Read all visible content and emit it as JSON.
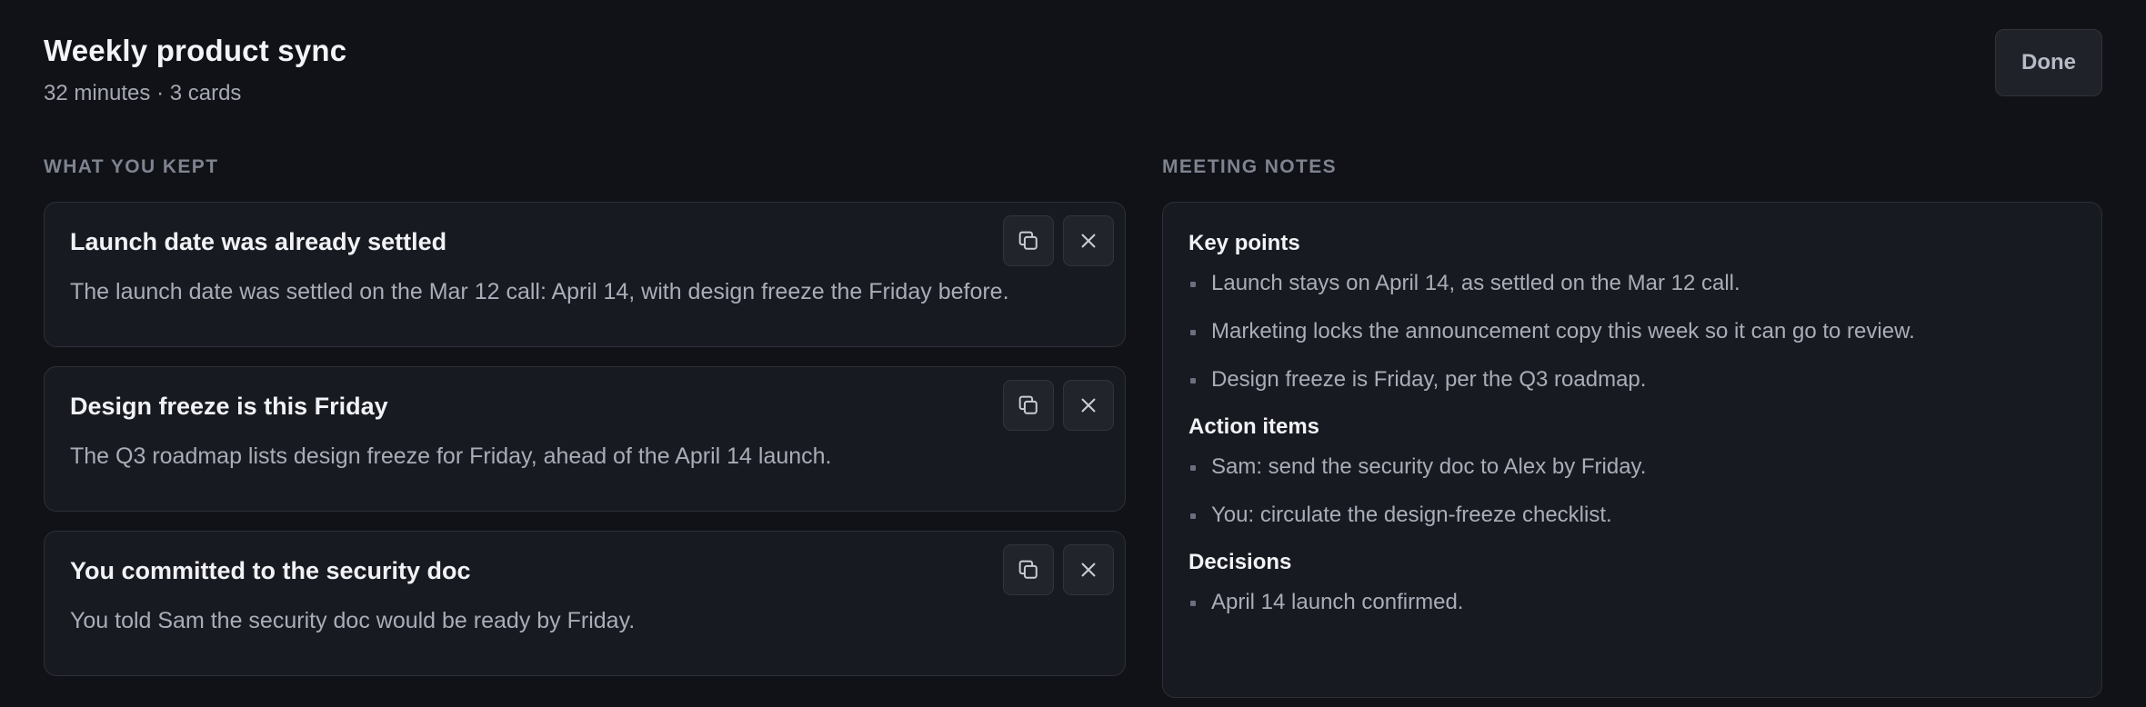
{
  "header": {
    "title": "Weekly product sync",
    "subtitle": "32 minutes · 3 cards",
    "done_label": "Done"
  },
  "kept": {
    "label": "WHAT YOU KEPT",
    "cards": [
      {
        "title": "Launch date was already settled",
        "body": "The launch date was settled on the Mar 12 call: April 14, with design freeze the Friday before."
      },
      {
        "title": "Design freeze is this Friday",
        "body": "The Q3 roadmap lists design freeze for Friday, ahead of the April 14 launch."
      },
      {
        "title": "You committed to the security doc",
        "body": "You told Sam the security doc would be ready by Friday."
      }
    ],
    "icons": {
      "copy": "copy-icon",
      "dismiss": "close-icon"
    }
  },
  "notes": {
    "label": "MEETING NOTES",
    "sections": [
      {
        "heading": "Key points",
        "items": [
          "Launch stays on April 14, as settled on the Mar 12 call.",
          "Marketing locks the announcement copy this week so it can go to review.",
          "Design freeze is Friday, per the Q3 roadmap."
        ]
      },
      {
        "heading": "Action items",
        "items": [
          "Sam: send the security doc to Alex by Friday.",
          "You: circulate the design-freeze checklist."
        ]
      },
      {
        "heading": "Decisions",
        "items": [
          "April 14 launch confirmed."
        ]
      }
    ]
  },
  "colors": {
    "background": "#111217",
    "card": "#181a21",
    "border": "#2c3038",
    "muted": "#a9adb8"
  }
}
